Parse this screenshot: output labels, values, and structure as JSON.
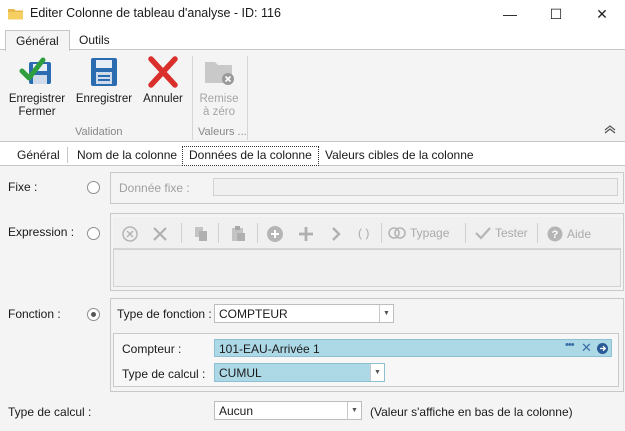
{
  "window": {
    "title": "Editer Colonne de tableau d'analyse - ID: 116",
    "buttons": {
      "minimize": "—",
      "maximize": "☐",
      "close": "✕"
    }
  },
  "ribbon": {
    "tabs": [
      {
        "label": "Général",
        "active": true
      },
      {
        "label": "Outils",
        "active": false
      }
    ],
    "groups": {
      "validation": {
        "label": "Validation",
        "buttons": [
          {
            "label": "Enregistrer\nFermer",
            "icon": "save-close-icon"
          },
          {
            "label": "Enregistrer",
            "icon": "floppy-disk-icon"
          },
          {
            "label": "Annuler",
            "icon": "red-x-icon"
          }
        ]
      },
      "valeurs": {
        "label": "Valeurs ...",
        "buttons": [
          {
            "label": "Remise\nà zéro",
            "icon": "folder-reset-icon",
            "disabled": true
          }
        ]
      }
    },
    "collapse_icon": "chevron-up-icon"
  },
  "subtabs": [
    {
      "label": "Général"
    },
    {
      "label": "Nom de la colonne"
    },
    {
      "label": "Données de la colonne",
      "active": true
    },
    {
      "label": "Valeurs cibles de la colonne"
    }
  ],
  "form": {
    "fixe": {
      "label": "Fixe :",
      "selected": false,
      "field_label": "Donnée fixe :",
      "value": ""
    },
    "expression": {
      "label": "Expression :",
      "selected": false,
      "toolbar": [
        {
          "icon": "circle-x-icon"
        },
        {
          "icon": "x-icon"
        },
        {
          "icon": "copy-icon"
        },
        {
          "icon": "paste-icon"
        },
        {
          "icon": "circle-plus-icon"
        },
        {
          "icon": "plus-icon"
        },
        {
          "icon": "chevron-right-icon"
        },
        {
          "icon": "parentheses-icon",
          "label": "( )"
        },
        {
          "icon": "typage-icon",
          "label": "Typage"
        },
        {
          "icon": "check-icon",
          "label": "Tester"
        },
        {
          "icon": "help-icon",
          "label": "Aide"
        }
      ]
    },
    "fonction": {
      "label": "Fonction :",
      "selected": true,
      "type_label": "Type de fonction :",
      "type_value": "COMPTEUR",
      "compteur_label": "Compteur :",
      "compteur_value": "101-EAU-Arrivée 1",
      "calcul_label": "Type de calcul :",
      "calcul_value": "CUMUL"
    },
    "type_calcul": {
      "label": "Type de calcul :",
      "value": "Aucun",
      "hint": "(Valeur s'affiche en bas de la colonne)"
    }
  },
  "colors": {
    "accent_field": "#add8e6",
    "ribbon_bg": "#f4f4f4",
    "cancel_red": "#d9302c",
    "save_blue": "#2b6cb0",
    "check_green": "#2e9e3e"
  }
}
